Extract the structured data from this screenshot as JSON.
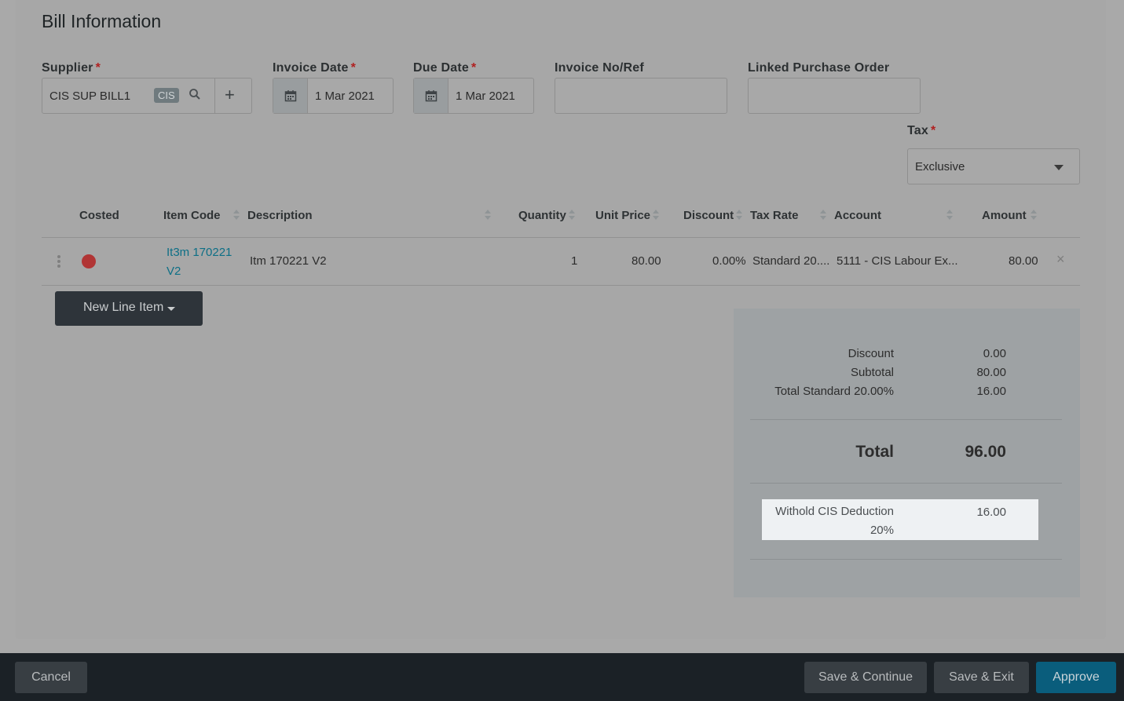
{
  "section_title": "Bill Information",
  "fields": {
    "supplier": {
      "label": "Supplier",
      "value": "CIS SUP BILL1",
      "badge": "CIS",
      "add_symbol": "+"
    },
    "invoice_date": {
      "label": "Invoice Date",
      "value": "1 Mar 2021"
    },
    "due_date": {
      "label": "Due Date",
      "value": "1 Mar 2021"
    },
    "invoice_ref": {
      "label": "Invoice No/Ref",
      "value": ""
    },
    "linked_po": {
      "label": "Linked Purchase Order",
      "value": ""
    },
    "tax": {
      "label": "Tax",
      "value": "Exclusive"
    },
    "required_marker": "*"
  },
  "table": {
    "headers": {
      "costed": "Costed",
      "item_code": "Item Code",
      "description": "Description",
      "quantity": "Quantity",
      "unit_price": "Unit Price",
      "discount": "Discount",
      "tax_rate": "Tax Rate",
      "account": "Account",
      "amount": "Amount"
    },
    "rows": [
      {
        "costed_status_color": "#b13535",
        "item_code_line1": "It3m 170221",
        "item_code_line2": "V2",
        "description": "Itm 170221 V2",
        "quantity": "1",
        "unit_price": "80.00",
        "discount": "0.00%",
        "tax_rate": "Standard 20....",
        "account": "5111 - CIS Labour Ex...",
        "amount": "80.00",
        "remove_symbol": "×"
      }
    ]
  },
  "new_line_button": "New Line Item",
  "totals": {
    "discount_label": "Discount",
    "discount_value": "0.00",
    "subtotal_label": "Subtotal",
    "subtotal_value": "80.00",
    "tax_label": "Total Standard 20.00%",
    "tax_value": "16.00",
    "total_label": "Total",
    "total_value": "96.00",
    "cis_label_line1": "Withold CIS Deduction",
    "cis_label_line2": "20%",
    "cis_value": "16.00"
  },
  "footer": {
    "cancel": "Cancel",
    "save_continue": "Save & Continue",
    "save_exit": "Save & Exit",
    "approve": "Approve"
  }
}
